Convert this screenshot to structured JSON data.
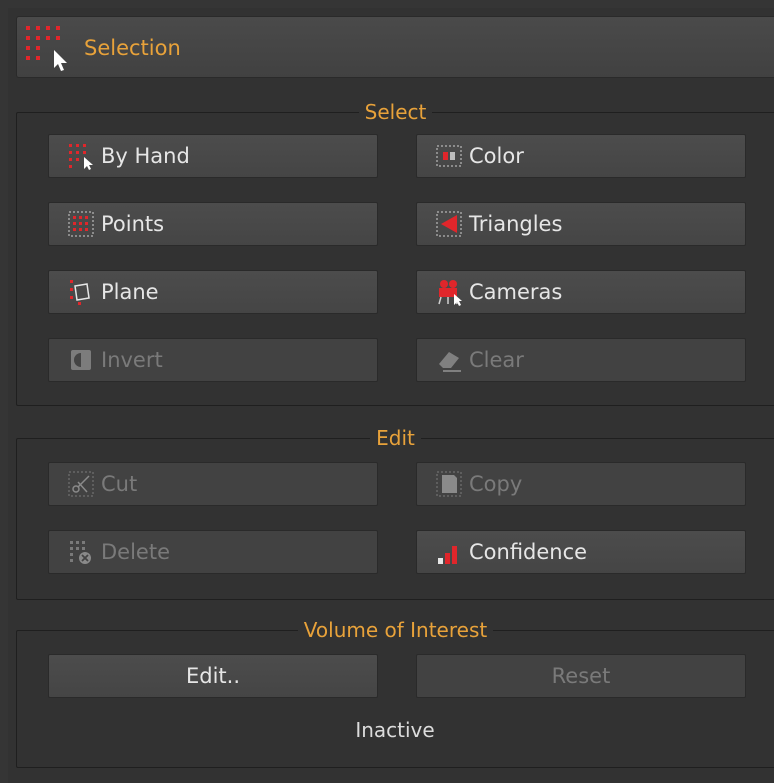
{
  "panel": {
    "title": "Selection"
  },
  "select_group": {
    "title": "Select",
    "buttons": {
      "by_hand": "By Hand",
      "color": "Color",
      "points": "Points",
      "triangles": "Triangles",
      "plane": "Plane",
      "cameras": "Cameras",
      "invert": "Invert",
      "clear": "Clear"
    }
  },
  "edit_group": {
    "title": "Edit",
    "buttons": {
      "cut": "Cut",
      "copy": "Copy",
      "delete": "Delete",
      "confidence": "Confidence"
    }
  },
  "voi_group": {
    "title": "Volume of Interest",
    "buttons": {
      "edit": "Edit..",
      "reset": "Reset"
    },
    "status": "Inactive"
  },
  "colors": {
    "accent": "#e8a23a",
    "icon_red": "#e0262b"
  }
}
